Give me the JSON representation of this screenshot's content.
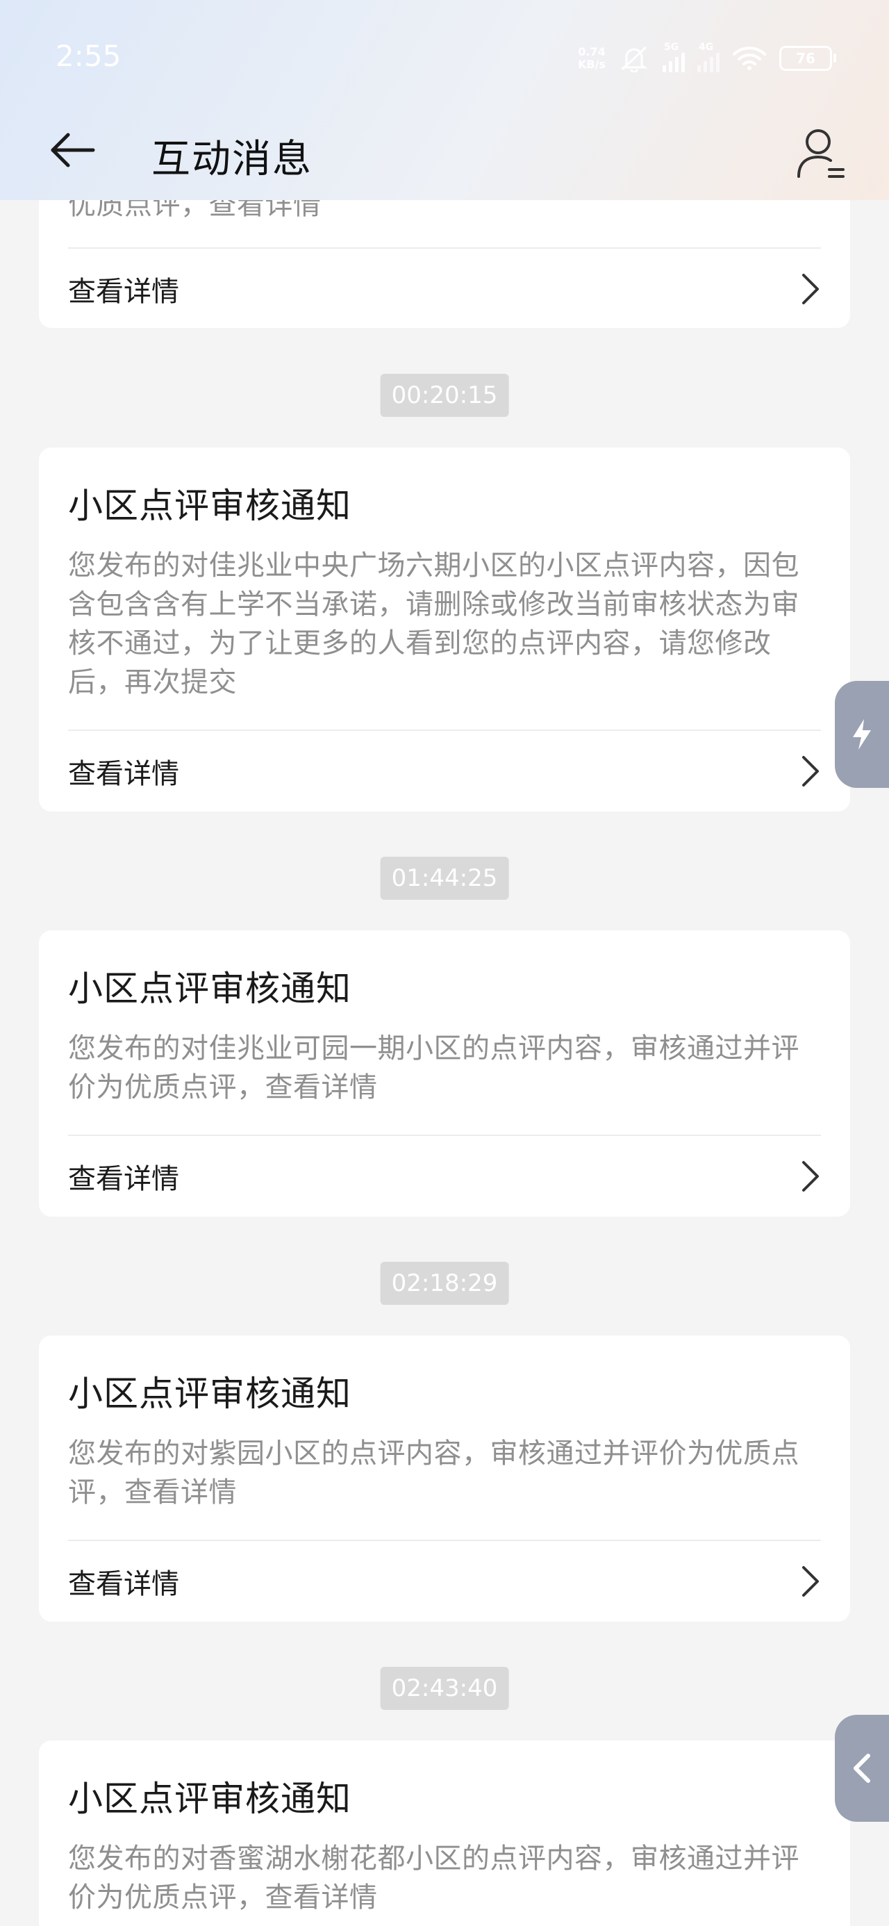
{
  "status_bar": {
    "time": "2:55",
    "net_speed_value": "0.74",
    "net_speed_unit": "KB/s",
    "signal_1_label": "5G",
    "signal_2_label": "4G",
    "battery": "76"
  },
  "header": {
    "title": "互动消息"
  },
  "partial_card": {
    "text_tail": "优质点评，查看详情",
    "detail_label": "查看详情"
  },
  "messages": [
    {
      "time": "00:20:15",
      "title": "小区点评审核通知",
      "body": "您发布的对佳兆业中央广场六期小区的小区点评内容，因包含包含含有上学不当承诺，请删除或修改当前审核状态为审核不通过，为了让更多的人看到您的点评内容，请您修改后，再次提交",
      "detail_label": "查看详情"
    },
    {
      "time": "01:44:25",
      "title": "小区点评审核通知",
      "body": "您发布的对佳兆业可园一期小区的点评内容，审核通过并评价为优质点评，查看详情",
      "detail_label": "查看详情"
    },
    {
      "time": "02:18:29",
      "title": "小区点评审核通知",
      "body": "您发布的对紫园小区的点评内容，审核通过并评价为优质点评，查看详情",
      "detail_label": "查看详情"
    },
    {
      "time": "02:43:40",
      "title": "小区点评审核通知",
      "body": "您发布的对香蜜湖水榭花都小区的点评内容，审核通过并评价为优质点评，查看详情",
      "detail_label": "查看详情"
    }
  ],
  "icons": {
    "back": "arrow-left-icon",
    "profile": "user-icon",
    "chevron": "chevron-right-icon",
    "flash": "lightning-icon",
    "collapse": "chevron-left-icon"
  }
}
